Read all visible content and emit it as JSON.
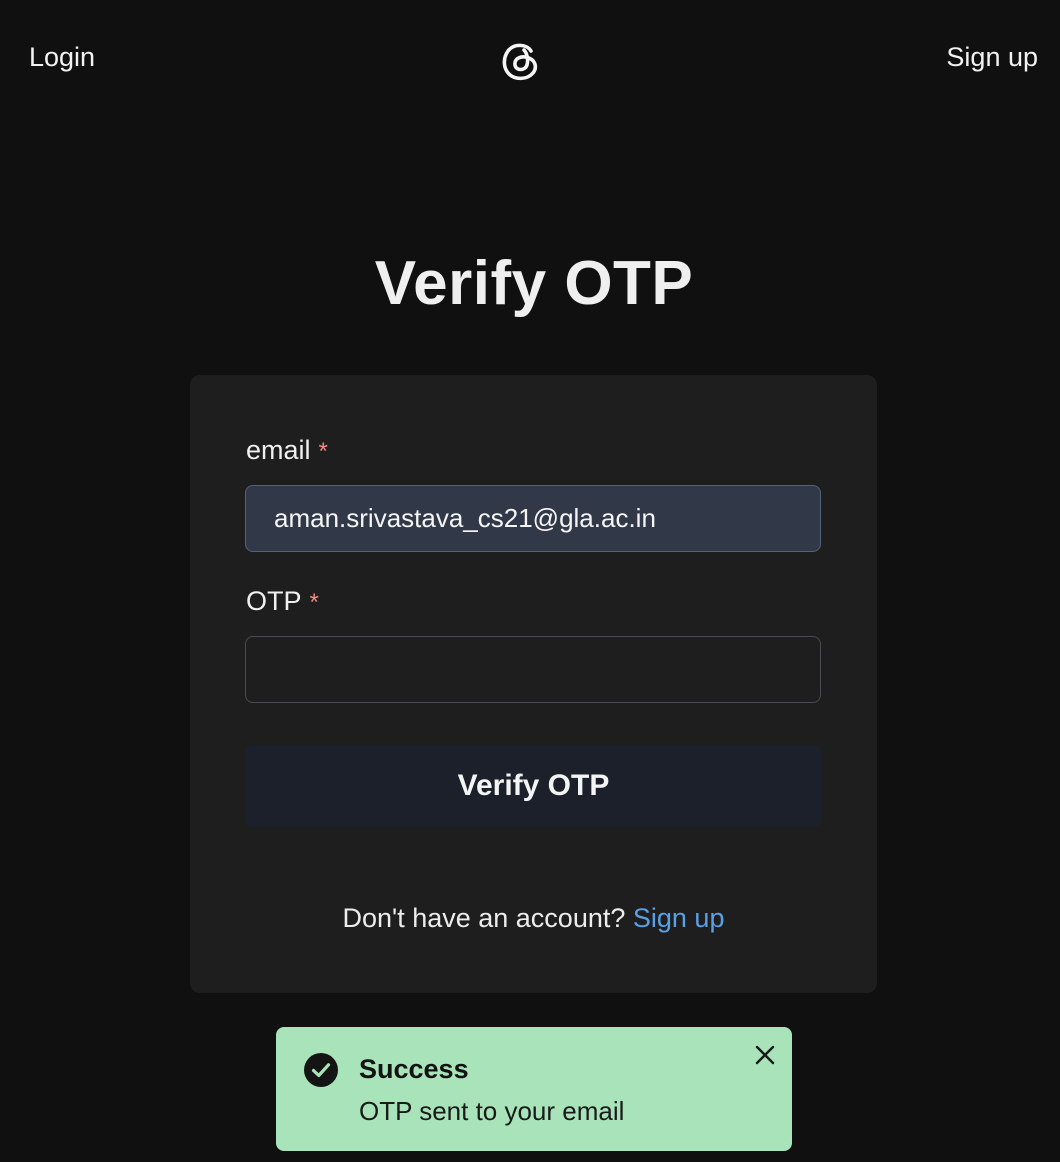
{
  "nav": {
    "login_label": "Login",
    "signup_label": "Sign up",
    "logo_icon": "threads-logo-icon"
  },
  "page": {
    "title": "Verify OTP"
  },
  "form": {
    "email_label": "email",
    "email_required_mark": "*",
    "email_value": "aman.srivastava_cs21@gla.ac.in",
    "otp_label": "OTP",
    "otp_required_mark": "*",
    "otp_value": "",
    "submit_label": "Verify OTP",
    "footer_text": "Don't have an account?",
    "footer_link": "Sign up"
  },
  "toast": {
    "title": "Success",
    "message": "OTP sent to your email",
    "status_icon": "check-circle-icon",
    "close_icon": "close-icon"
  },
  "colors": {
    "background": "#101010",
    "card": "#1e1e1f",
    "link": "#5aa0e6",
    "required": "#f28b82",
    "toast_bg": "#a8e3b9"
  }
}
